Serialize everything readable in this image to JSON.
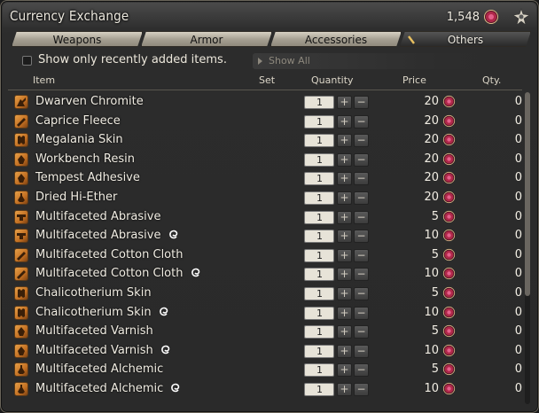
{
  "window": {
    "title": "Currency Exchange"
  },
  "currency": {
    "amount": "1,548",
    "icon": "seal-currency-icon"
  },
  "tabs": [
    {
      "label": "Weapons",
      "active": false
    },
    {
      "label": "Armor",
      "active": false
    },
    {
      "label": "Accessories",
      "active": false
    },
    {
      "label": "Others",
      "active": true
    }
  ],
  "filter": {
    "checkbox_label": "Show only recently added items.",
    "checked": false,
    "dropdown_value": "Show All"
  },
  "columns": {
    "item": "Item",
    "set": "Set",
    "quantity": "Quantity",
    "price": "Price",
    "qty": "Qty."
  },
  "items": [
    {
      "name": "Dwarven Chromite",
      "hq": false,
      "quantity": "1",
      "price": "20",
      "qty": "0",
      "icon": "ore-icon"
    },
    {
      "name": "Caprice Fleece",
      "hq": false,
      "quantity": "1",
      "price": "20",
      "qty": "0",
      "icon": "cloth-icon"
    },
    {
      "name": "Megalania Skin",
      "hq": false,
      "quantity": "1",
      "price": "20",
      "qty": "0",
      "icon": "skin-icon"
    },
    {
      "name": "Workbench Resin",
      "hq": false,
      "quantity": "1",
      "price": "20",
      "qty": "0",
      "icon": "resin-icon"
    },
    {
      "name": "Tempest Adhesive",
      "hq": false,
      "quantity": "1",
      "price": "20",
      "qty": "0",
      "icon": "resin-icon"
    },
    {
      "name": "Dried Hi-Ether",
      "hq": false,
      "quantity": "1",
      "price": "20",
      "qty": "0",
      "icon": "potion-icon"
    },
    {
      "name": "Multifaceted Abrasive",
      "hq": false,
      "quantity": "1",
      "price": "5",
      "qty": "0",
      "icon": "abrasive-icon"
    },
    {
      "name": "Multifaceted Abrasive",
      "hq": true,
      "quantity": "1",
      "price": "10",
      "qty": "0",
      "icon": "abrasive-icon"
    },
    {
      "name": "Multifaceted Cotton Cloth",
      "hq": false,
      "quantity": "1",
      "price": "5",
      "qty": "0",
      "icon": "cloth-icon"
    },
    {
      "name": "Multifaceted Cotton Cloth",
      "hq": true,
      "quantity": "1",
      "price": "10",
      "qty": "0",
      "icon": "cloth-icon"
    },
    {
      "name": "Chalicotherium Skin",
      "hq": false,
      "quantity": "1",
      "price": "5",
      "qty": "0",
      "icon": "skin-icon"
    },
    {
      "name": "Chalicotherium Skin",
      "hq": true,
      "quantity": "1",
      "price": "10",
      "qty": "0",
      "icon": "skin-icon"
    },
    {
      "name": "Multifaceted Varnish",
      "hq": false,
      "quantity": "1",
      "price": "5",
      "qty": "0",
      "icon": "resin-icon"
    },
    {
      "name": "Multifaceted Varnish",
      "hq": true,
      "quantity": "1",
      "price": "10",
      "qty": "0",
      "icon": "resin-icon"
    },
    {
      "name": "Multifaceted Alchemic",
      "hq": false,
      "quantity": "1",
      "price": "5",
      "qty": "0",
      "icon": "potion-icon"
    },
    {
      "name": "Multifaceted Alchemic",
      "hq": true,
      "quantity": "1",
      "price": "10",
      "qty": "0",
      "icon": "potion-icon"
    }
  ],
  "stepper": {
    "plus": "+",
    "minus": "−"
  },
  "colors": {
    "accent": "#c26f22",
    "currency": "#b0284a",
    "hq": "#ffffff"
  }
}
